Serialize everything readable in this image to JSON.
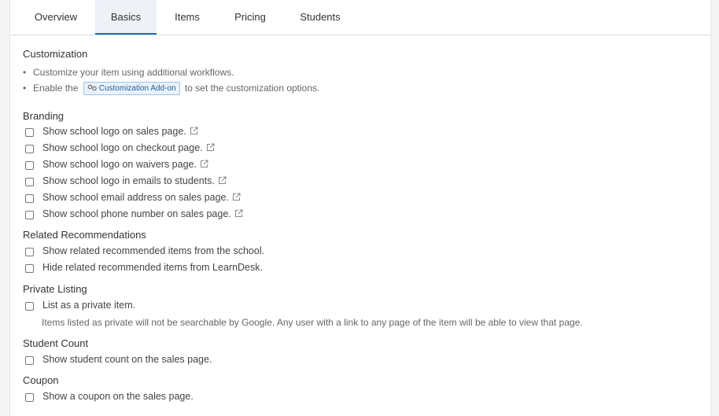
{
  "tabs": [
    {
      "label": "Overview"
    },
    {
      "label": "Basics"
    },
    {
      "label": "Items"
    },
    {
      "label": "Pricing"
    },
    {
      "label": "Students"
    }
  ],
  "customization": {
    "title": "Customization",
    "bullet1": "Customize your item using additional workflows.",
    "bullet2_prefix": "Enable the",
    "addon_label": "Customization Add-on",
    "bullet2_suffix": "to set the customization options."
  },
  "branding": {
    "title": "Branding",
    "options": [
      "Show school logo on sales page.",
      "Show school logo on checkout page.",
      "Show school logo on waivers page.",
      "Show school logo in emails to students.",
      "Show school email address on sales page.",
      "Show school phone number on sales page."
    ]
  },
  "related": {
    "title": "Related Recommendations",
    "options": [
      "Show related recommended items from the school.",
      "Hide related recommended items from LearnDesk."
    ]
  },
  "private": {
    "title": "Private Listing",
    "option": "List as a private item.",
    "note": "Items listed as private will not be searchable by Google. Any user with a link to any page of the item will be able to view that page."
  },
  "student_count": {
    "title": "Student Count",
    "option": "Show student count on the sales page."
  },
  "coupon": {
    "title": "Coupon",
    "option": "Show a coupon on the sales page."
  }
}
